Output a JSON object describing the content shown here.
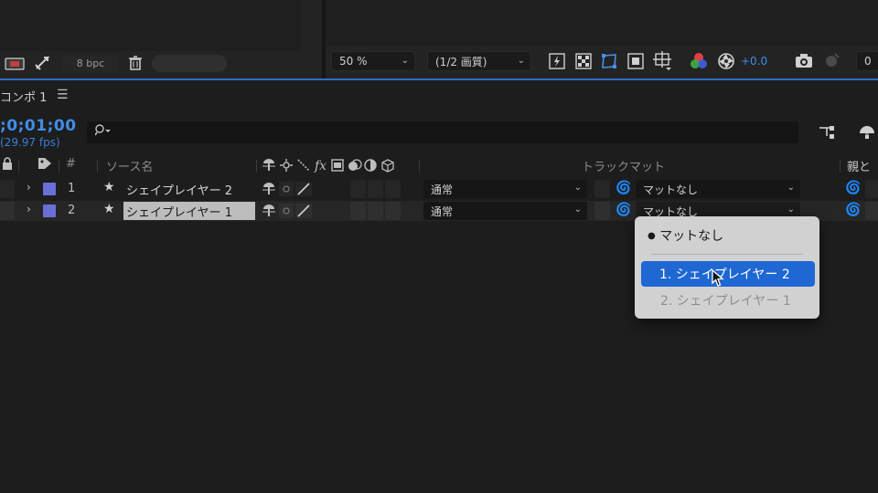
{
  "project_toolbar": {
    "bpc_label": "8 bpc"
  },
  "viewer_toolbar": {
    "zoom_value": "50 %",
    "resolution_value": "(1/2 画質)",
    "exposure_value": "+0.0",
    "right_partial": "0"
  },
  "timeline": {
    "tab_title": "コンポ 1",
    "timecode": ";0;01;00",
    "fps": "(29.97 fps)",
    "headers": {
      "hash": "#",
      "source_name": "ソース名",
      "fx": "fx",
      "track_matte": "トラックマット",
      "parent": "親と"
    },
    "layers": [
      {
        "index": "1",
        "name": "シェイプレイヤー 2",
        "mode": "通常",
        "matte": "マットなし",
        "color": "#6870d8"
      },
      {
        "index": "2",
        "name": "シェイプレイヤー 1",
        "mode": "通常",
        "matte": "マットなし",
        "color": "#6870d8"
      }
    ]
  },
  "matte_menu": {
    "items": [
      {
        "label": "マットなし",
        "state": "checked"
      },
      {
        "label": "1. シェイプレイヤー 2",
        "state": "highlighted"
      },
      {
        "label": "2. シェイプレイヤー 1",
        "state": "disabled"
      }
    ],
    "check_mark": "●"
  },
  "colors": {
    "accent_blue": "#2e6cc8",
    "timecode_blue": "#3f8ee8",
    "highlight_blue": "#1f67d3",
    "label_color": "#6870d8"
  }
}
